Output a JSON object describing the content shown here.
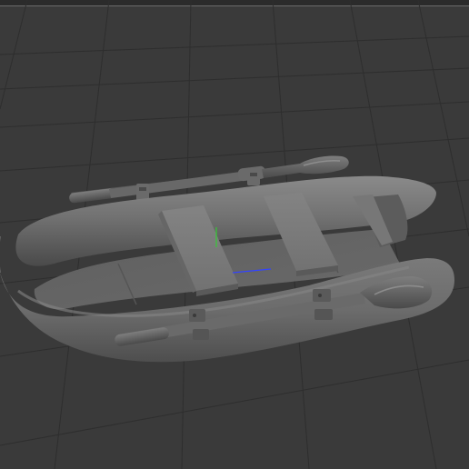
{
  "viewport": {
    "background_color": "#3a3a3a",
    "grid_color": "#2b2b2b",
    "model_color": "#6e6e6e",
    "axis_y_color": "#33cc33",
    "axis_x_color": "#3344ff"
  },
  "model": {
    "parts": [
      "hull",
      "transom",
      "floor",
      "seat-front",
      "seat-rear",
      "oar-back",
      "oar-front",
      "oarlocks"
    ]
  }
}
